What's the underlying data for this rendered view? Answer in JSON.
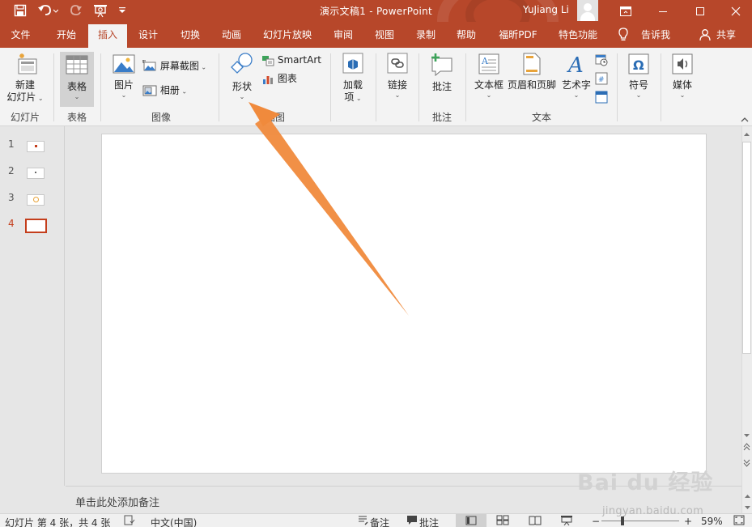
{
  "app": {
    "document_title": "演示文稿1  -  PowerPoint",
    "user_name": "YuJiang Li"
  },
  "tabs": [
    "文件",
    "开始",
    "插入",
    "设计",
    "切换",
    "动画",
    "幻灯片放映",
    "审阅",
    "视图",
    "录制",
    "帮助",
    "福昕PDF",
    "特色功能"
  ],
  "active_tab": "插入",
  "tell_me": "告诉我",
  "share": "共享",
  "ribbon": {
    "new_slide": {
      "line1": "新建",
      "line2": "幻灯片"
    },
    "table": "表格",
    "picture": "图片",
    "screenshot": "屏幕截图",
    "album": "相册",
    "shapes": "形状",
    "smartart": "SmartArt",
    "chart": "图表",
    "addins": {
      "line1": "加载",
      "line2": "项"
    },
    "link": "链接",
    "comment": "批注",
    "textbox": "文本框",
    "header_footer": "页眉和页脚",
    "wordart": "艺术字",
    "symbol": "符号",
    "media": "媒体",
    "groups": {
      "slides": "幻灯片",
      "tables": "表格",
      "images": "图像",
      "illustrations": "插图",
      "comments": "批注",
      "text": "文本"
    }
  },
  "slides": [
    {
      "num": "1"
    },
    {
      "num": "2"
    },
    {
      "num": "3"
    },
    {
      "num": "4"
    }
  ],
  "notes_placeholder": "单击此处添加备注",
  "status": {
    "slide_info": "幻灯片 第 4 张，共 4 张",
    "language": "中文(中国)",
    "notes": "备注",
    "comments": "批注",
    "zoom": "59%",
    "zoom_minus": "−",
    "zoom_plus": "+",
    "zoom_level": 0.59
  },
  "watermark": {
    "logo": "Bai du 经验",
    "url": "jingyan.baidu.com"
  },
  "colors": {
    "accent": "#b7472a",
    "current_slide": "#c43e1c",
    "arrow": "#f08a3c"
  }
}
